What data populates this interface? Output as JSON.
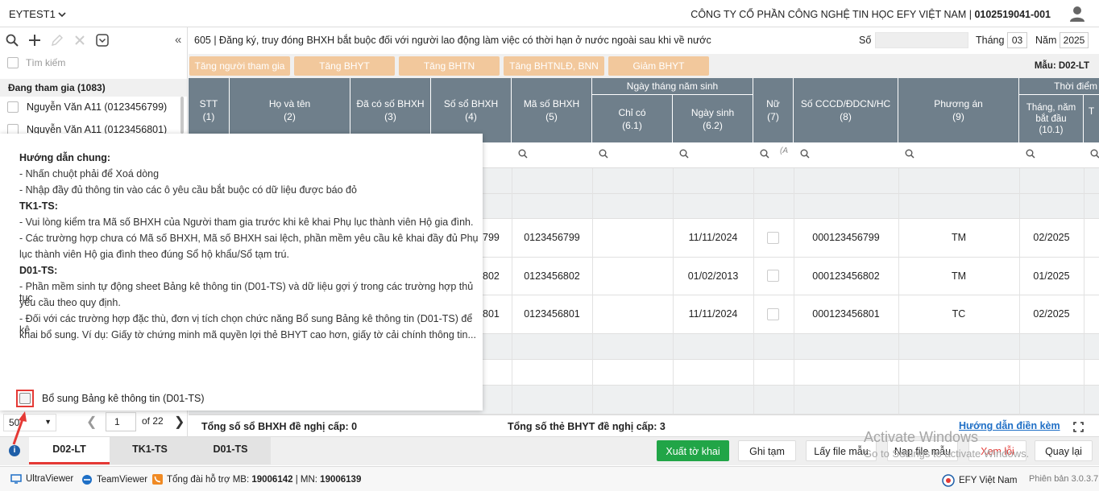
{
  "header": {
    "tenant": "EYTEST1",
    "company_name": "CÔNG TY CỔ PHẦN CÔNG NGHỆ TIN HỌC EFY VIỆT NAM | ",
    "tax_code": "0102519041-001"
  },
  "left_panel": {
    "search_placeholder": "Tìm kiếm",
    "group_title": "Đang tham gia (1083)",
    "items": [
      {
        "label": "Nguyễn Văn A11 (0123456799)"
      },
      {
        "label": "Nguyễn Văn A11 (0123456801)"
      }
    ]
  },
  "form": {
    "title": "605 | Đăng ký, truy đóng BHXH bắt buộc đối với người lao động làm việc có thời hạn ở nước ngoài sau khi về nước",
    "so_label": "Số",
    "so_value": "",
    "thang_label": "Tháng",
    "thang_value": "03",
    "nam_label": "Năm",
    "nam_value": "2025",
    "action_buttons": [
      "Tăng người tham gia",
      "Tăng BHYT",
      "Tăng BHTN",
      "Tăng BHTNLĐ, BNN",
      "Giảm BHYT"
    ],
    "mau": "Mẫu: D02-LT"
  },
  "table": {
    "columns": [
      {
        "l1": "STT",
        "l2": "(1)"
      },
      {
        "l1": "Họ và tên",
        "l2": "(2)"
      },
      {
        "l1": "Đã có số BHXH",
        "l2": "(3)"
      },
      {
        "l1": "Số sổ BHXH",
        "l2": "(4)"
      },
      {
        "l1": "Mã số BHXH",
        "l2": "(5)"
      },
      {
        "l1": "Chỉ có",
        "l2": "(6.1)"
      },
      {
        "l1": "Ngày sinh",
        "l2": "(6.2)"
      },
      {
        "l1": "Nữ",
        "l2": "(7)"
      },
      {
        "l1": "Số CCCD/ĐDCN/HC",
        "l2": "(8)"
      },
      {
        "l1": "Phương án",
        "l2": "(9)"
      },
      {
        "l1": "Tháng, năm bắt đầu",
        "l2": "(10.1)"
      },
      {
        "l1": "T",
        "l2": ""
      }
    ],
    "group_dob": "Ngày tháng năm sinh",
    "group_time": "Thời điểm",
    "filter_all": "(A",
    "rows": [
      {
        "so_so_partial": "799",
        "ma_so": "0123456799",
        "ngay_sinh": "11/11/2024",
        "cccd": "000123456799",
        "phuong_an": "TM",
        "thang_bd": "02/2025"
      },
      {
        "so_so_partial": "802",
        "ma_so": "0123456802",
        "ngay_sinh": "01/02/2013",
        "cccd": "000123456802",
        "phuong_an": "TM",
        "thang_bd": "01/2025"
      },
      {
        "so_so_partial": "801",
        "ma_so": "0123456801",
        "ngay_sinh": "11/11/2024",
        "cccd": "000123456801",
        "phuong_an": "TC",
        "thang_bd": "02/2025"
      }
    ]
  },
  "popup": {
    "lines": [
      {
        "text": "Hướng dẫn chung:",
        "bold": true
      },
      {
        "text": "- Nhấn chuột phải để Xoá dòng"
      },
      {
        "text": "- Nhập đầy đủ thông tin vào các ô yêu cầu bắt buộc có dữ liệu được báo đỏ"
      },
      {
        "text": "TK1-TS:",
        "bold": true
      },
      {
        "text": "- Vui lòng kiểm tra Mã số BHXH của Người tham gia trước khi kê khai Phụ lục thành viên Hộ gia đình."
      },
      {
        "text": "- Các trường hợp chưa có Mã số BHXH, Mã số BHXH sai lệch, phần mềm yêu cầu kê khai đầy đủ Phụ"
      },
      {
        "text": "lục thành viên Hộ gia đình theo đúng Sổ hộ khẩu/Sổ tạm trú."
      },
      {
        "text": "D01-TS:",
        "bold": true
      },
      {
        "text": "- Phần mềm sinh tự động sheet Bảng kê thông tin (D01-TS) và dữ liệu gợi ý trong các trường hợp thủ tục"
      },
      {
        "text": "yêu cầu theo quy định."
      },
      {
        "text": "- Đối với các trường hợp đặc thù, đơn vị tích chọn chức năng Bổ sung Bảng kê thông tin (D01-TS) để kê"
      },
      {
        "text": "khai bổ sung. Ví dụ: Giấy tờ chứng minh mã quyền lợi thẻ BHYT cao hơn, giấy tờ cải chính thông tin..."
      }
    ],
    "checkbox_label": "Bổ sung Bảng kê thông tin (D01-TS)"
  },
  "pager": {
    "page_size": "50",
    "current_page": "1",
    "of_label": "of",
    "total_pages": "22"
  },
  "summary": {
    "so_bhxh": "Tổng số sổ BHXH đề nghị cấp: 0",
    "the_bhyt": "Tổng số thẻ BHYT đề nghị cấp: 3",
    "guide_link": "Hướng dẫn điền kèm"
  },
  "tabs": [
    "D02-LT",
    "TK1-TS",
    "D01-TS"
  ],
  "bottom_buttons": {
    "xuat": "Xuất tờ khai",
    "ghi_tam": "Ghi tạm",
    "lay_file": "Lấy file mẫu",
    "nap_file": "Nạp file mẫu",
    "xem_loi": "Xem lỗi",
    "quay_lai": "Quay lại"
  },
  "watermark": {
    "line1": "Activate Windows",
    "line2": "Go to Settings to activate Windows."
  },
  "taskbar": {
    "ultraviewer": "UltraViewer",
    "teamviewer": "TeamViewer",
    "hotline_prefix": "Tổng đài hỗ trợ MB: ",
    "hotline_mb": "19006142",
    "hotline_sep": " | MN: ",
    "hotline_mn": "19006139",
    "brand": "EFY Việt Nam",
    "version": "Phiên bản 3.0.3.7"
  },
  "colors": {
    "table_header": "#6f7f8b",
    "orange_button": "#f2c89c",
    "green_button": "#21a547",
    "accent_red": "#e53935",
    "link_blue": "#1f6fc6"
  }
}
